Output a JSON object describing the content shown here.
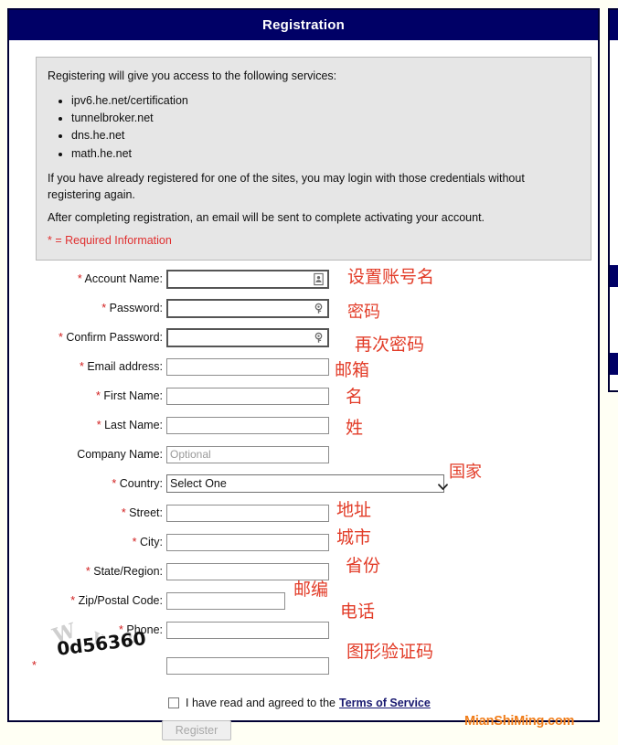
{
  "header": {
    "title": "Registration"
  },
  "info": {
    "intro": "Registering will give you access to the following services:",
    "services": [
      "ipv6.he.net/certification",
      "tunnelbroker.net",
      "dns.he.net",
      "math.he.net"
    ],
    "login_note": "If you have already registered for one of the sites, you may login with those credentials without registering again.",
    "email_note": "After completing registration, an email will be sent to complete activating your account.",
    "required_note": "* = Required Information"
  },
  "form": {
    "fields": [
      {
        "label": "Account Name:",
        "required": true,
        "value": "",
        "placeholder": "",
        "icon": "contact-card-autofill-icon",
        "annotation": "设置账号名"
      },
      {
        "label": "Password:",
        "required": true,
        "value": "",
        "placeholder": "",
        "icon": "key-autofill-icon",
        "annotation": "密码"
      },
      {
        "label": "Confirm Password:",
        "required": true,
        "value": "",
        "placeholder": "",
        "icon": "key-autofill-icon",
        "annotation": "再次密码"
      },
      {
        "label": "Email address:",
        "required": true,
        "value": "",
        "placeholder": "",
        "icon": "",
        "annotation": "邮箱"
      },
      {
        "label": "First Name:",
        "required": true,
        "value": "",
        "placeholder": "",
        "icon": "",
        "annotation": "名"
      },
      {
        "label": "Last Name:",
        "required": true,
        "value": "",
        "placeholder": "",
        "icon": "",
        "annotation": "姓"
      },
      {
        "label": "Company Name:",
        "required": false,
        "value": "",
        "placeholder": "Optional",
        "icon": "",
        "annotation": ""
      }
    ],
    "country": {
      "label": "Country:",
      "required": true,
      "selected": "Select One",
      "options": [
        "Select One"
      ],
      "annotation": "国家"
    },
    "address_fields": [
      {
        "label": "Street:",
        "required": true,
        "value": "",
        "narrow": false,
        "annotation": "地址"
      },
      {
        "label": "City:",
        "required": true,
        "value": "",
        "narrow": false,
        "annotation": "城市"
      },
      {
        "label": "State/Region:",
        "required": true,
        "value": "",
        "narrow": false,
        "annotation": "省份"
      },
      {
        "label": "Zip/Postal Code:",
        "required": true,
        "value": "",
        "narrow": true,
        "annotation": "邮编"
      },
      {
        "label": "Phone:",
        "required": true,
        "value": "",
        "narrow": false,
        "annotation": "电话"
      }
    ],
    "captcha": {
      "text": "0d56360",
      "noise": [
        "W",
        "y",
        "2"
      ],
      "value": "",
      "annotation": "图形验证码"
    },
    "terms": {
      "checked": false,
      "text": "I have read and agreed to the",
      "link_label": "Terms of Service"
    },
    "submit_label": "Register"
  },
  "watermark": {
    "text": "MianShiMing.com"
  },
  "colors": {
    "header_bg": "#000066",
    "info_bg": "#e6e6e6",
    "required_red": "#e03030",
    "annotation_red": "#e23c28",
    "link_navy": "#191970",
    "watermark_orange": "#f07d1a"
  }
}
